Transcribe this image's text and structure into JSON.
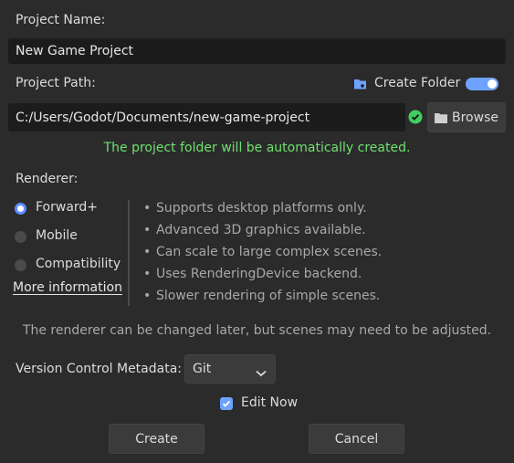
{
  "project_name": {
    "label": "Project Name:",
    "value": "New Game Project"
  },
  "project_path": {
    "label": "Project Path:",
    "value": "C:/Users/Godot/Documents/new-game-project",
    "create_folder_label": "Create Folder",
    "create_folder_on": true,
    "browse_label": "Browse",
    "status_message": "The project folder will be automatically created."
  },
  "renderer": {
    "label": "Renderer:",
    "options": [
      "Forward+",
      "Mobile",
      "Compatibility"
    ],
    "selected": "Forward+",
    "more_info_label": "More information",
    "features": [
      "Supports desktop platforms only.",
      "Advanced 3D graphics available.",
      "Can scale to large complex scenes.",
      "Uses RenderingDevice backend.",
      "Slower rendering of simple scenes."
    ],
    "note": "The renderer can be changed later, but scenes may need to be adjusted."
  },
  "version_control": {
    "label": "Version Control Metadata:",
    "selected": "Git"
  },
  "edit_now": {
    "label": "Edit Now",
    "checked": true
  },
  "buttons": {
    "create": "Create",
    "cancel": "Cancel"
  },
  "colors": {
    "accent": "#6ea2ff",
    "success": "#6ee06e",
    "background": "#2b2b2b"
  }
}
